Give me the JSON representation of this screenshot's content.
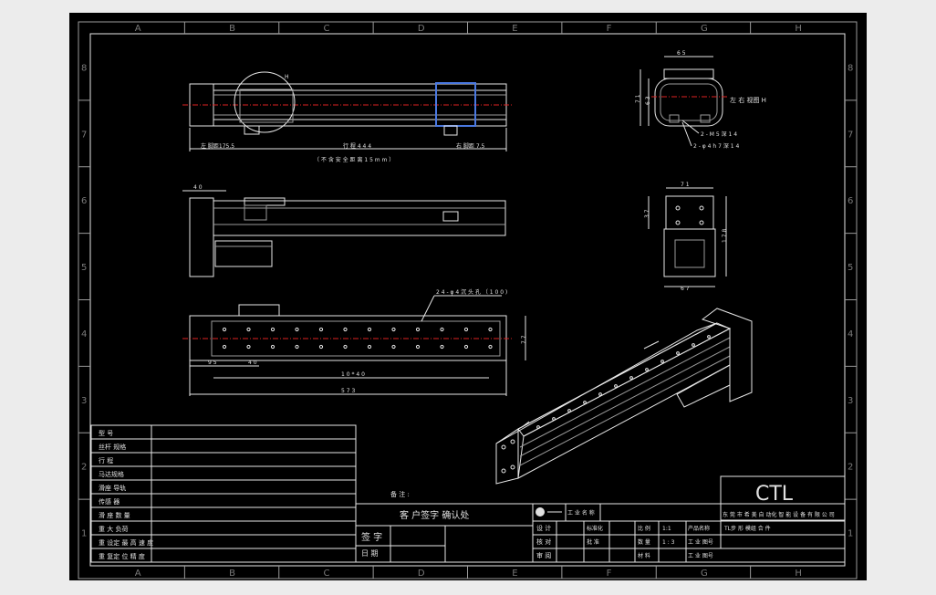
{
  "colors": {
    "background": "#000000",
    "outer_frame": "#ececec",
    "line": "#e6e6e6",
    "centerline": "#dd2222",
    "highlight": "#4a78e0",
    "zone_text": "#7a7a7a"
  },
  "zones": {
    "columns": [
      "A",
      "B",
      "C",
      "D",
      "E",
      "F",
      "G",
      "H"
    ],
    "rows": [
      "8",
      "7",
      "6",
      "5",
      "4",
      "3",
      "2",
      "1"
    ]
  },
  "views": {
    "top": {
      "detail_marker": "H",
      "dim_left": "左 脚距175.5",
      "dim_stroke": "行 程 4 4 4",
      "dim_right": "右 脚距 7.5",
      "note": "（ 不 含 安 全 距 离 1 5 m m ）"
    },
    "front": {
      "dim_left": "4 0"
    },
    "bottom": {
      "callout": "2 4 - φ 4 沉 头 孔 （ 1 0 0 )",
      "dim_height": "7 7",
      "dim_a": "9 5",
      "dim_b": "4 0",
      "dim_pitch": "1 0 * 4 0",
      "dim_total": "5 7 3"
    },
    "end_view": {
      "dim_width": "6 5",
      "dim_height_a": "7 1",
      "dim_height_b": "6 3",
      "label": "左 右 视图 H",
      "note1": "2 - M 5 深 1 4",
      "note2": "2 - φ 4 h 7 深 1 4"
    },
    "motor_view": {
      "dim_width": "7 1",
      "dim_height_a": "3 7",
      "dim_height_b": "1 7 8",
      "dim_bottom": "6 7"
    }
  },
  "spec_table": {
    "rows": [
      "型 号",
      "丝杆 规格",
      "行 程",
      "马达规格",
      "滑座 导轨",
      "传感 器",
      "滑 座 数 量",
      "重 大 负荷",
      "重 设定 最 高 速 度",
      "重 复定 位 精 度"
    ]
  },
  "customer": {
    "remark": "备 注 :",
    "title": "客 户签字 确认处",
    "signature": "签 字",
    "date": "日 期"
  },
  "title_block": {
    "logo": "CTL",
    "company": "东 莞 市 希 美 自 动化 智 能 设 备 有 限 公 司",
    "project_label": "工 业 名 称",
    "product_name": "产品名称",
    "drawing_name": "TL步 形 模组 合 件",
    "designer": "设 计",
    "checker": "核 对",
    "approver": "审 阅",
    "standard": "标准化",
    "approval": "批 准",
    "scale_label": "比 例",
    "scale": "1:1",
    "quantity": "数 量",
    "ratio": "1 : 3",
    "material": "材 料",
    "drawing_no": "工 业 图号",
    "part_no": "工 业 图号"
  }
}
